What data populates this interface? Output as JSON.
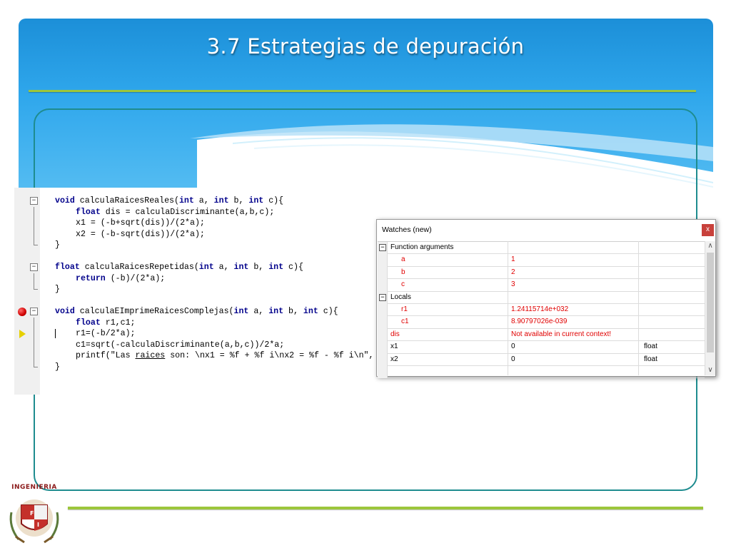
{
  "slide": {
    "title": "3.7  Estrategias de depuración"
  },
  "colors": {
    "accent_green": "#9cc63b",
    "frame_teal": "#1e8c8f",
    "header_blue": "#2fa7ec",
    "keyword": "#00008b",
    "watch_red": "#e00000"
  },
  "code": {
    "lines": [
      {
        "pre": "",
        "kw": "void",
        "rest": " calculaRaicesReales(",
        "parts": [
          [
            "int",
            " a, "
          ],
          [
            "int",
            " b, "
          ],
          [
            "int",
            " c){"
          ]
        ]
      },
      {
        "kw": "float",
        "rest": " dis = calculaDiscriminante(a,b,c);"
      },
      {
        "text": "x1 = (-b+sqrt(dis))/(2*a);"
      },
      {
        "text": "x2 = (-b-sqrt(dis))/(2*a);"
      },
      {
        "text": "}"
      },
      {
        "text": ""
      },
      {
        "kw": "float",
        "rest": " calculaRaicesRepetidas(",
        "parts": [
          [
            "int",
            " a, "
          ],
          [
            "int",
            " b, "
          ],
          [
            "int",
            " c){"
          ]
        ]
      },
      {
        "kw": "return",
        "rest": " (-b)/(2*a);"
      },
      {
        "text": "}"
      },
      {
        "text": ""
      },
      {
        "kw": "void",
        "rest": " calculaEImprimeRaicesComplejas(",
        "parts": [
          [
            "int",
            " a, "
          ],
          [
            "int",
            " b, "
          ],
          [
            "int",
            " c){"
          ]
        ]
      },
      {
        "kw": "float",
        "rest": " r1,c1;"
      },
      {
        "text": "r1=(-b/2*a);"
      },
      {
        "text": "c1=sqrt(-calculaDiscriminante(a,b,c))/2*a;"
      },
      {
        "pre": "printf(\"Las ",
        "u": "raices",
        "post": " son: \\nx1 = %f + %f i\\nx2 = %f - %f i\\n\","
      },
      {
        "text": "}"
      }
    ]
  },
  "watches": {
    "title": "Watches (new)",
    "close_label": "x",
    "rows": [
      {
        "name": "Function arguments",
        "value": "",
        "type": "",
        "group": true,
        "expander": "−"
      },
      {
        "name": "a",
        "value": "1",
        "type": "",
        "child": true
      },
      {
        "name": "b",
        "value": "2",
        "type": "",
        "child": true
      },
      {
        "name": "c",
        "value": "3",
        "type": "",
        "child": true
      },
      {
        "name": "Locals",
        "value": "",
        "type": "",
        "group": true,
        "expander": "−"
      },
      {
        "name": "r1",
        "value": "1.24115714e+032",
        "type": "",
        "child": true
      },
      {
        "name": "c1",
        "value": "8.90797026e-039",
        "type": "",
        "child": true
      },
      {
        "name": "dis",
        "value": "Not available in current context!",
        "type": "",
        "red": true
      },
      {
        "name": "x1",
        "value": "0",
        "type": "float"
      },
      {
        "name": "x2",
        "value": "0",
        "type": "float"
      },
      {
        "name": "",
        "value": "",
        "type": ""
      }
    ],
    "scroll_up": "∧",
    "scroll_down": "∨"
  },
  "logo": {
    "text": "INGENIERIA",
    "icon": "faculty-crest-icon"
  }
}
